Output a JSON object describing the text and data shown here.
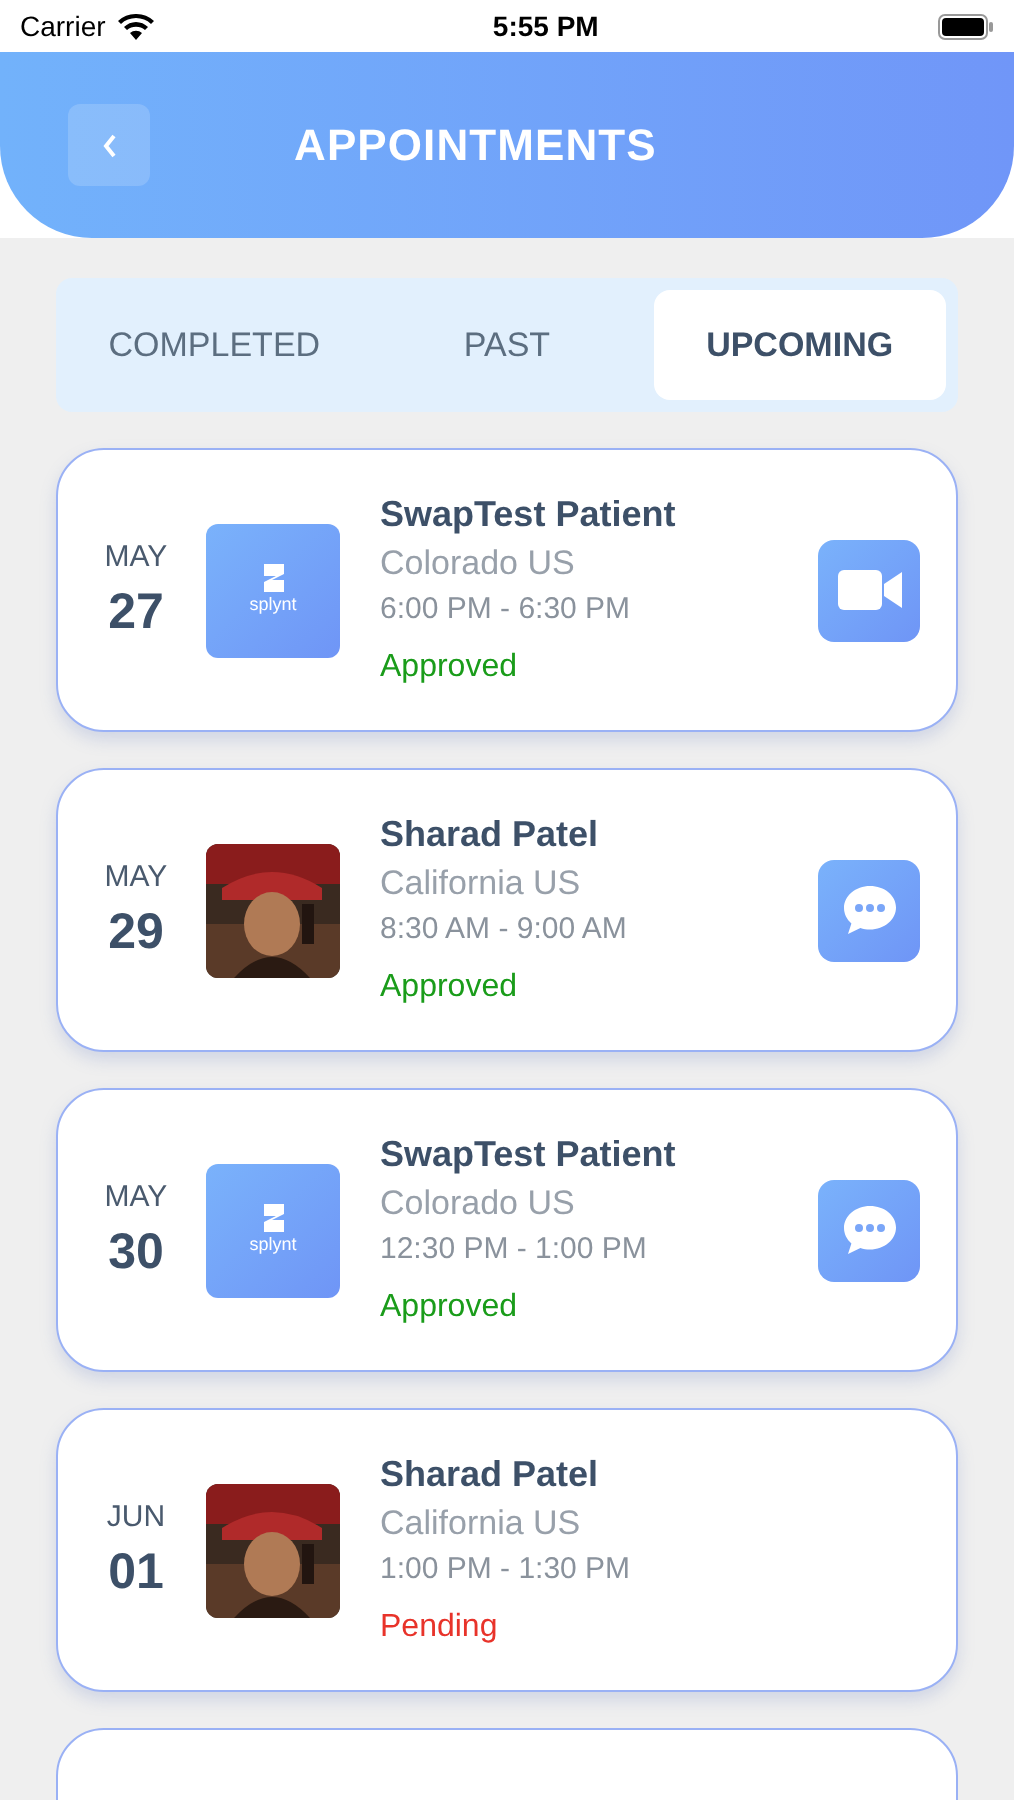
{
  "status_bar": {
    "carrier": "Carrier",
    "time": "5:55 PM"
  },
  "header": {
    "title": "APPOINTMENTS"
  },
  "tabs": [
    {
      "label": "COMPLETED",
      "selected": false
    },
    {
      "label": "PAST",
      "selected": false
    },
    {
      "label": "UPCOMING",
      "selected": true
    }
  ],
  "appointments": [
    {
      "month": "MAY",
      "day": "27",
      "avatar": {
        "kind": "logo",
        "text": "splynt"
      },
      "name": "SwapTest Patient",
      "location": "Colorado US",
      "time": "6:00 PM - 6:30 PM",
      "status": "Approved",
      "color": "#1a9c1a",
      "action_button": {
        "kind": "video"
      }
    },
    {
      "month": "MAY",
      "day": "29",
      "name": "Sharad Patel",
      "location": "California US",
      "time": "8:30 AM - 9:00 AM",
      "status": "Approved",
      "color": "#1a9c1a",
      "action_button": {
        "kind": "chat"
      }
    },
    {
      "month": "MAY",
      "day": "30",
      "avatar": {
        "kind": "logo",
        "text": "splynt"
      },
      "name": "SwapTest Patient",
      "location": "Colorado US",
      "time": "12:30 PM - 1:00 PM",
      "status": "Approved",
      "color": "#1a9c1a",
      "action_button": {
        "kind": "chat"
      }
    },
    {
      "month": "JUN",
      "day": "01",
      "name": "Sharad Patel",
      "location": "California US",
      "time": "1:00 PM - 1:30 PM",
      "status": "Pending",
      "color": "#e8332a"
    }
  ]
}
